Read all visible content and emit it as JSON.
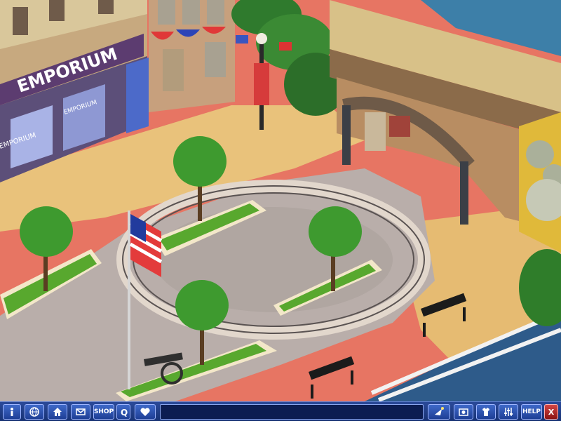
{
  "scene": {
    "store_sign": "EMPORIUM",
    "window_sign_1": "EMPORIUM",
    "window_sign_2": "EMPORIUM"
  },
  "toolbar": {
    "info_icon": "info-icon",
    "globe_icon": "globe-icon",
    "house_icon": "house-icon",
    "mail_icon": "mail-icon",
    "shop_label": "SHOP",
    "question_icon": "question-icon",
    "heart_icon": "heart-icon",
    "chat_value": "",
    "send_icon": "send-icon",
    "photo_icon": "photo-icon",
    "shirt_icon": "shirt-icon",
    "sliders_icon": "sliders-icon",
    "help_label": "HELP",
    "close_label": "X"
  },
  "colors": {
    "toolbar_bg": "#1f3b85",
    "button_border": "#9fb6ff",
    "brick": "#e06f5f",
    "sidewalk": "#e8c07a",
    "road": "#b5aaa5",
    "grass": "#5aa22e"
  }
}
